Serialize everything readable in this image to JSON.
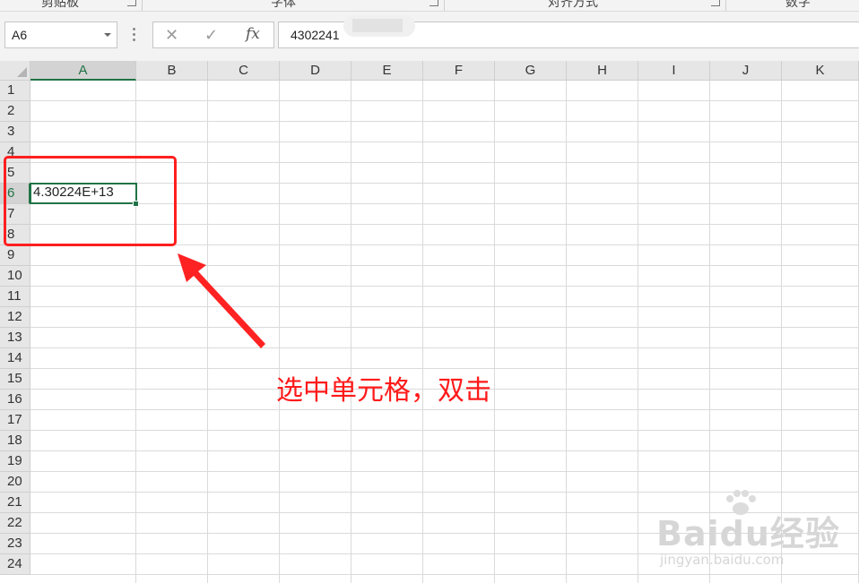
{
  "ribbon": {
    "groups": [
      {
        "label": "剪贴板"
      },
      {
        "label": "字体"
      },
      {
        "label": "对齐方式"
      },
      {
        "label": "数字"
      }
    ]
  },
  "formula_bar": {
    "name_box": "A6",
    "cancel_icon": "✕",
    "enter_icon": "✓",
    "fx_label": "fx",
    "formula_value": "4302241"
  },
  "columns": [
    "A",
    "B",
    "C",
    "D",
    "E",
    "F",
    "G",
    "H",
    "I",
    "J",
    "K"
  ],
  "rows": [
    "1",
    "2",
    "3",
    "4",
    "5",
    "6",
    "7",
    "8",
    "9",
    "10",
    "11",
    "12",
    "13",
    "14",
    "15",
    "16",
    "17",
    "18",
    "19",
    "20",
    "21",
    "22",
    "23",
    "24"
  ],
  "active_cell": {
    "ref": "A6",
    "value": "4.30224E+13"
  },
  "annotation": {
    "text": "选中单元格，双击",
    "color": "#ff1f1f"
  },
  "watermark": {
    "main": "Baidu经验",
    "sub": "jingyan.baidu.com"
  },
  "colors": {
    "excel_green": "#217346",
    "header_bg": "#e6e6e6",
    "grid_line": "#dadada"
  }
}
